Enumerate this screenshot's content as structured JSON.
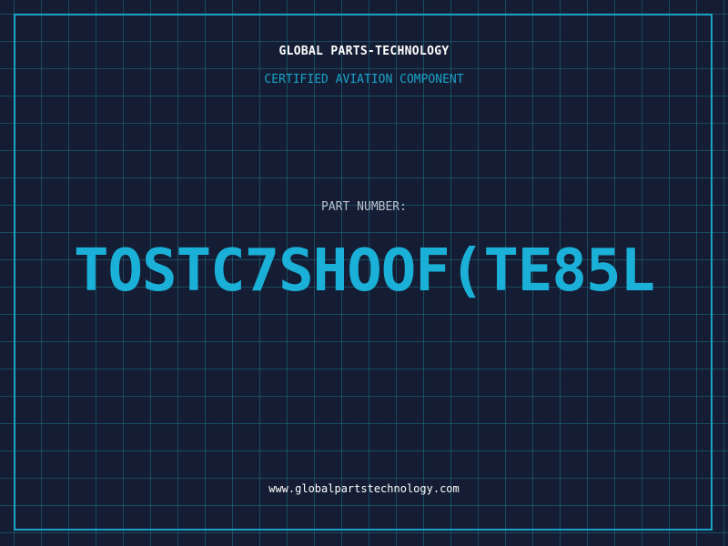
{
  "header": {
    "company": "GLOBAL PARTS-TECHNOLOGY",
    "subtitle": "CERTIFIED AVIATION COMPONENT"
  },
  "part": {
    "label": "PART NUMBER:",
    "number": "TOSTC7SHOOF(TE85L"
  },
  "footer": {
    "url": "www.globalpartstechnology.com"
  },
  "colors": {
    "background": "#141d33",
    "accent": "#1aa3c8",
    "part_number": "#1ab0d8",
    "label": "#b8c0cc",
    "text": "#ffffff"
  }
}
